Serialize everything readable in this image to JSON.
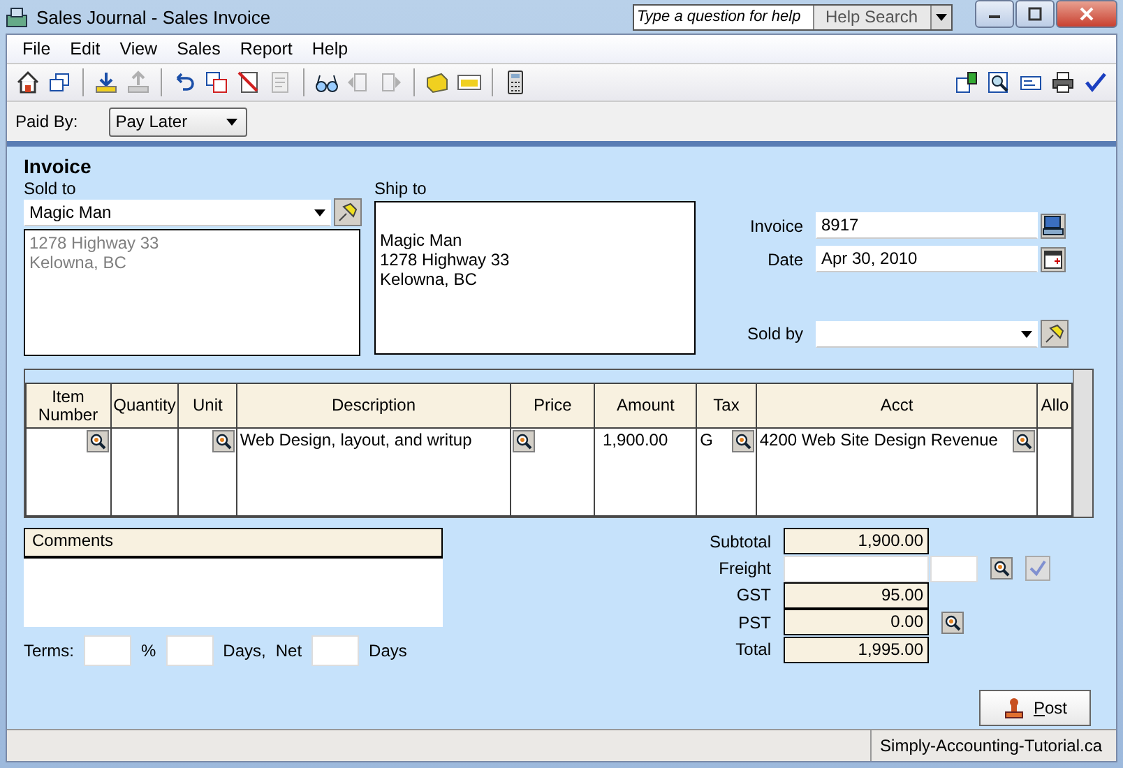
{
  "window": {
    "title": "Sales Journal - Sales Invoice"
  },
  "help": {
    "placeholder": "Type a question for help",
    "button": "Help Search"
  },
  "menu": [
    "File",
    "Edit",
    "View",
    "Sales",
    "Report",
    "Help"
  ],
  "toolbar": [
    {
      "kind": "home",
      "disabled": false
    },
    {
      "kind": "windows",
      "disabled": false
    },
    {
      "kind": "sep"
    },
    {
      "kind": "download",
      "disabled": false
    },
    {
      "kind": "upload",
      "disabled": true
    },
    {
      "kind": "sep"
    },
    {
      "kind": "undo",
      "disabled": false
    },
    {
      "kind": "copy",
      "disabled": false
    },
    {
      "kind": "cancel",
      "disabled": false
    },
    {
      "kind": "document",
      "disabled": true
    },
    {
      "kind": "sep"
    },
    {
      "kind": "glasses",
      "disabled": false
    },
    {
      "kind": "prev",
      "disabled": true
    },
    {
      "kind": "next",
      "disabled": true
    },
    {
      "kind": "sep"
    },
    {
      "kind": "note",
      "disabled": false
    },
    {
      "kind": "card",
      "disabled": false
    },
    {
      "kind": "sep"
    },
    {
      "kind": "calculator",
      "disabled": false
    }
  ],
  "toolbar_right": [
    {
      "kind": "boxes",
      "disabled": false
    },
    {
      "kind": "preview",
      "disabled": false
    },
    {
      "kind": "mail",
      "disabled": false
    },
    {
      "kind": "printer",
      "disabled": false
    },
    {
      "kind": "check",
      "disabled": false
    }
  ],
  "paid_by": {
    "label": "Paid By:",
    "value": "Pay Later"
  },
  "invoice": {
    "heading": "Invoice",
    "sold_to": {
      "label": "Sold to",
      "value": "Magic Man",
      "address": [
        "1278 Highway 33",
        "Kelowna, BC"
      ]
    },
    "ship_to": {
      "label": "Ship to",
      "lines": [
        "Magic Man",
        "1278 Highway 33",
        "Kelowna, BC"
      ]
    },
    "number": {
      "label": "Invoice",
      "value": "8917"
    },
    "date": {
      "label": "Date",
      "value": "Apr 30, 2010"
    },
    "sold_by": {
      "label": "Sold by"
    }
  },
  "table": {
    "columns": [
      "Item Number",
      "Quantity",
      "Unit",
      "Description",
      "Price",
      "Amount",
      "Tax",
      "Acct",
      "Allo"
    ],
    "rows": [
      {
        "cells": [
          {
            "lookup": true
          },
          {
            "lookup": false
          },
          {
            "lookup": true
          },
          {
            "text": "Web Design, layout, and writup",
            "lookup": false
          },
          {
            "lookup": true
          },
          {
            "text": "1,900.00",
            "lookup": false
          },
          {
            "text": "G",
            "lookup": true
          },
          {
            "text": "4200 Web Site Design Revenue",
            "lookup": true
          },
          {
            "lookup": false
          }
        ]
      }
    ]
  },
  "comments": {
    "label": "Comments"
  },
  "terms": [
    {
      "kind": "label",
      "text": "Terms:"
    },
    {
      "kind": "field"
    },
    {
      "kind": "label",
      "text": "%"
    },
    {
      "kind": "field"
    },
    {
      "kind": "label",
      "text": "Days,"
    },
    {
      "kind": "label",
      "text": "Net"
    },
    {
      "kind": "field"
    },
    {
      "kind": "label",
      "text": "Days"
    }
  ],
  "totals": [
    {
      "kind": "readonly",
      "label": "Subtotal",
      "value": "1,900.00",
      "lookup": false
    },
    {
      "kind": "input",
      "label": "Freight",
      "lookup": true
    },
    {
      "kind": "readonly",
      "label": "GST",
      "value": "95.00",
      "lookup": false
    },
    {
      "kind": "readonly",
      "label": "PST",
      "value": "0.00",
      "lookup": true
    },
    {
      "kind": "readonly",
      "label": "Total",
      "value": "1,995.00",
      "lookup": false
    }
  ],
  "post": {
    "label": "Post"
  },
  "status_bar": "Simply-Accounting-Tutorial.ca"
}
